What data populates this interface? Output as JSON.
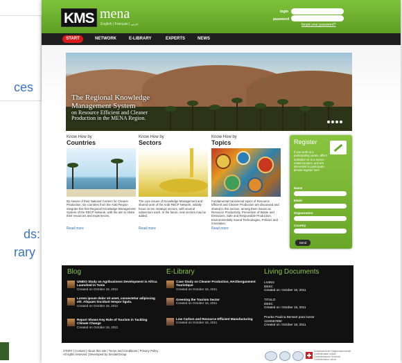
{
  "background_slide": {
    "fragment_1": "ces",
    "fragment_2": "ds:",
    "fragment_3": "rary"
  },
  "header": {
    "logo": "KMS",
    "site_name": "mena",
    "languages": "English | Français | عربي",
    "login_label": "login",
    "password_label": "password",
    "forgot_link": "forgot your password?"
  },
  "nav": {
    "start": "START",
    "network": "NETWORK",
    "elibrary": "E-LIBRARY",
    "experts": "EXPERTS",
    "news": "NEWS"
  },
  "hero": {
    "line1": "The Regional Knowledge",
    "line2": "Management System",
    "line3": "on Resource Efficient and Cleaner",
    "line4": "Production in the MENA Region."
  },
  "columns": [
    {
      "kicker": "Know How by",
      "title": "Countries",
      "text": "By means of their National Centers for Cleaner Production, six countries from the Arab Region integrate this first Regional Knowledge Management System of the RECP Network, with the aim to share their resources and experiences.",
      "more": "Read more"
    },
    {
      "kicker": "Know How by",
      "title": "Sectors",
      "text": "The core issues of Knowledge Management and shared work of the Arab RECP Network, initially focus on ten strategic sectors, with several subsectors each. In the future, new sectors may be added.",
      "more": "Read more"
    },
    {
      "kicker": "Know How by",
      "title": "Topics",
      "text": "Fundamental transversal topics of Resource Efficient and Cleaner Production are discussed and shared in this section, among them issues as Resource Productivity, Prevention of Waste and Emissions, Safe and Responsible Production, Environmentally Sound Technologies, Policies and Innovation.",
      "more": "Read more"
    }
  ],
  "register": {
    "title": "Register",
    "text": "If you work at a participating centre, affect institution or in a sector-related project, and are interested to participate, please register here",
    "name": "Name",
    "email": "EMail",
    "organization": "Organization",
    "country": "Country",
    "send": "Send"
  },
  "blog": {
    "heading": "Blog",
    "posts": [
      {
        "title": "UNIDO Study on Agribusiness Development in Africa Launched in Tunis",
        "date": "Created on October 16, 2011"
      },
      {
        "title": "Lorem ipsum dolor sit amet, consectetur adipiscing elit. Aliquam tincidunt tempor ligula.",
        "date": "Created on October 16, 2011"
      },
      {
        "title": "Report Shows Key Role of Tourism in Tackling Climate Change",
        "date": "Created on October 16, 2011"
      }
    ]
  },
  "elibrary": {
    "heading": "E-Library",
    "items": [
      {
        "title": "Case Study on Cleaner Production, HAOberganment Touristique",
        "date": "Created on October 16, 2011"
      },
      {
        "title": "Greening the Tourism Sector",
        "date": "Created on October 16, 2011"
      },
      {
        "title": "Low Carbon and Resource Efficient Manufacturing",
        "date": "Created on October 16, 2011"
      }
    ]
  },
  "living_documents": {
    "heading": "Living Documents",
    "items": [
      {
        "title": "LIVING",
        "sub": "DESC",
        "date": "Created on: October 16, 2011"
      },
      {
        "title": "TITULO",
        "sub": "DESC",
        "date": "Created on: October 16, 2011"
      },
      {
        "title": "Prueba Paulina Berwart para borrar",
        "sub": "1234567890",
        "date": "Created on: October 16, 2011"
      }
    ]
  },
  "footer": {
    "links": "START | Contact | About this site | Terms and Conditions | Privacy Policy",
    "rights": "All rights reserved | Developed by SinclairGroup",
    "confederation": "Schweizerische Eidgenossenschaft Confédération suisse Confederazione Svizzera Confederaziun svizra"
  },
  "colors": {
    "brand_green": "#6aa628",
    "nav_dark": "#1f1f1f",
    "start_red": "#d61a1a",
    "band_dark": "#111111",
    "link_blue": "#2f6fb7"
  }
}
